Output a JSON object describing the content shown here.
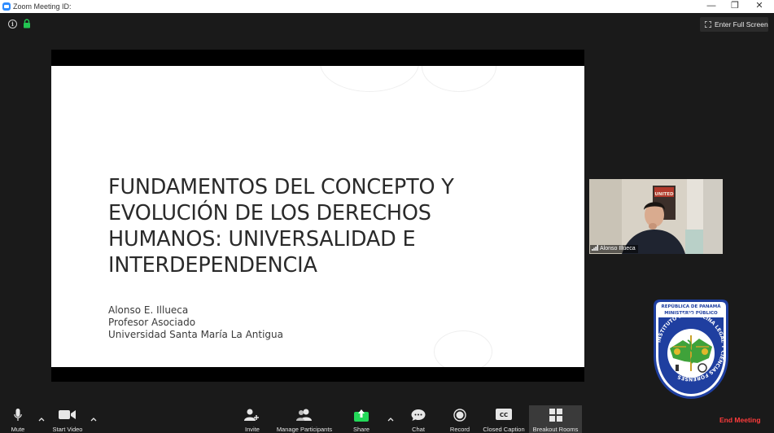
{
  "window": {
    "title": "Zoom Meeting ID:",
    "minimize": "—",
    "restore": "❐",
    "close": "✕"
  },
  "meeting_info_icon": "i",
  "fullscreen_label": "Enter Full Screen",
  "slide": {
    "title_lines": [
      "FUNDAMENTOS DEL CONCEPTO Y",
      "EVOLUCIÓN DE LOS DERECHOS",
      "HUMANOS: UNIVERSALIDAD E",
      "INTERDEPENDENCIA"
    ],
    "subtitle_lines": [
      "Alonso E. Illueca",
      "Profesor Asociado",
      "Universidad Santa María La Antigua"
    ]
  },
  "participant": {
    "name": "Alonso Illueca",
    "poster_text": "UNITED"
  },
  "seal": {
    "top_line_1": "REPÚBLICA DE PANAMÁ",
    "top_line_2": "MINISTERIO PÚBLICO",
    "ring_text": "INSTITUTO DE MEDICINA LEGAL Y CIENCIAS FORENSES"
  },
  "toolbar": {
    "mute": "Mute",
    "start_video": "Start Video",
    "invite": "Invite",
    "manage_participants": "Manage Participants",
    "share": "Share",
    "chat": "Chat",
    "record": "Record",
    "closed_caption": "Closed Caption",
    "cc_icon_text": "CC",
    "breakout_rooms": "Breakout Rooms",
    "end_meeting": "End Meeting"
  },
  "colors": {
    "toolbar_bg": "#1a1a1a",
    "share_green": "#23d959",
    "end_red": "#ff3b3b",
    "seal_blue": "#1f3fa0"
  }
}
